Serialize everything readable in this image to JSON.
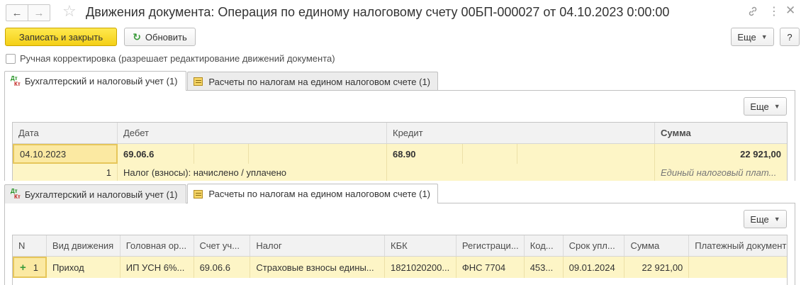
{
  "window": {
    "title": "Движения документа: Операция по единому налоговому счету 00БП-000027 от 04.10.2023 0:00:00",
    "back_glyph": "←",
    "forward_glyph": "→"
  },
  "toolbar": {
    "save_close_label": "Записать и закрыть",
    "refresh_label": "Обновить",
    "more_label": "Еще",
    "help_label": "?"
  },
  "manual_edit": {
    "label": "Ручная корректировка (разрешает редактирование движений документа)",
    "checked": false
  },
  "tabs_top": [
    {
      "label": "Бухгалтерский и налоговый учет (1)",
      "active": true,
      "icon": "dt-kt-icon"
    },
    {
      "label": "Расчеты по налогам на едином налоговом счете (1)",
      "active": false,
      "icon": "register-icon"
    }
  ],
  "tabs_bottom": [
    {
      "label": "Бухгалтерский и налоговый учет (1)",
      "active": false,
      "icon": "dt-kt-icon"
    },
    {
      "label": "Расчеты по налогам на едином налоговом счете (1)",
      "active": true,
      "icon": "register-icon"
    }
  ],
  "panel_more_label": "Еще",
  "accounting_table": {
    "columns": [
      "Дата",
      "Дебет",
      "Кредит",
      "Сумма"
    ],
    "row": {
      "date": "04.10.2023",
      "line_number": "1",
      "debit_account": "69.06.6",
      "credit_account": "68.90",
      "amount": "22 921,00",
      "content": "Налог (взносы): начислено / уплачено",
      "amount_note": "Единый налоговый плат..."
    }
  },
  "tax_table": {
    "columns": [
      "N",
      "Вид движения",
      "Головная ор...",
      "Счет уч...",
      "Налог",
      "КБК",
      "Регистраци...",
      "Код...",
      "Срок упл...",
      "Сумма",
      "Платежный документ"
    ],
    "row": {
      "plus": "+",
      "n": "1",
      "movement": "Приход",
      "org": "ИП УСН 6%...",
      "account": "69.06.6",
      "tax": "Страховые взносы едины...",
      "kbk": "1821020200...",
      "registration": "ФНС 7704",
      "code": "453...",
      "due_date": "09.01.2024",
      "amount": "22 921,00",
      "payment_doc": ""
    }
  },
  "colors": {
    "primary_button": "#f4cf16",
    "row_highlight": "#fdf5c6",
    "selected_cell": "#e6c65a"
  }
}
